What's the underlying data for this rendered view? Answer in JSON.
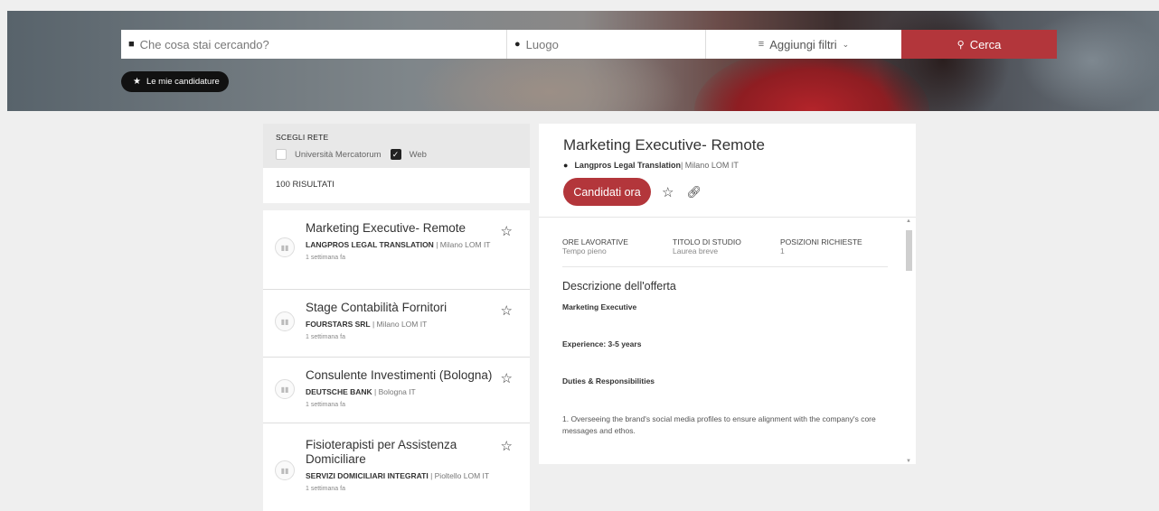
{
  "search": {
    "what_placeholder": "Che cosa stai cercando?",
    "where_placeholder": "Luogo",
    "filters_label": "Aggiungi filtri",
    "search_button": "Cerca"
  },
  "my_applications": "Le mie candidature",
  "filter_panel": {
    "title": "SCEGLI RETE",
    "options": [
      {
        "label": "Università Mercatorum",
        "checked": false
      },
      {
        "label": "Web",
        "checked": true
      }
    ],
    "results": "100 RISULTATI"
  },
  "jobs": [
    {
      "title": "Marketing Executive- Remote",
      "company": "LANGPROS LEGAL TRANSLATION",
      "location": " | Milano LOM IT",
      "date": "1 settimana fa"
    },
    {
      "title": "Stage Contabilità Fornitori",
      "company": "FOURSTARS SRL",
      "location": " | Milano LOM IT",
      "date": "1 settimana fa"
    },
    {
      "title": "Consulente Investimenti (Bologna)",
      "company": "DEUTSCHE BANK",
      "location": " | Bologna IT",
      "date": "1 settimana fa"
    },
    {
      "title": "Fisioterapisti per Assistenza Domiciliare",
      "company": "SERVIZI DOMICILIARI INTEGRATI",
      "location": " | Pioltello LOM IT",
      "date": "1 settimana fa"
    }
  ],
  "detail": {
    "title": "Marketing Executive- Remote",
    "company": "Langpros Legal Translation",
    "location": " | Milano LOM IT",
    "apply_button": "Candidati ora",
    "specs": [
      {
        "label": "ORE LAVORATIVE",
        "value": "Tempo pieno"
      },
      {
        "label": "TITOLO DI STUDIO",
        "value": "Laurea breve"
      },
      {
        "label": "POSIZIONI RICHIESTE",
        "value": "1"
      }
    ],
    "description_title": "Descrizione dell'offerta",
    "paragraphs": [
      "Marketing Executive",
      "Experience: 3-5 years",
      "Duties & Responsibilities",
      "1. Overseeing the brand's social media profiles to ensure alignment with the company's core messages and ethos."
    ]
  },
  "colors": {
    "accent": "#b3363b",
    "dark": "#111111",
    "background": "#efefef"
  }
}
